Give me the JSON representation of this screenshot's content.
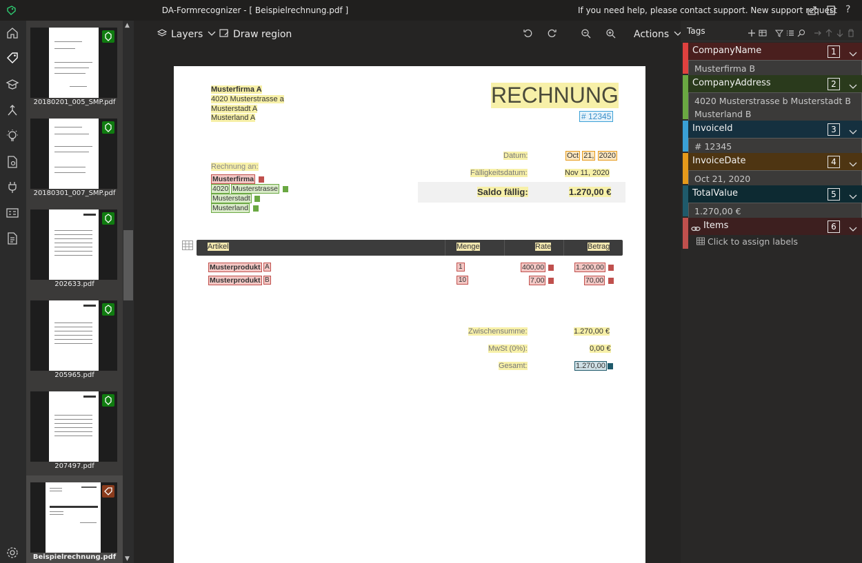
{
  "titlebar": {
    "title": "DA-Formrecognizer - [ Beispielrechnung.pdf ]",
    "help": "If you need help, please contact support. New support request"
  },
  "rail": [
    "home-icon",
    "tag-icon",
    "train-icon",
    "merge-icon",
    "lightbulb-icon",
    "document-analyze-icon",
    "plug-icon",
    "id-card-icon",
    "document-icon",
    "settings-icon"
  ],
  "thumbnails": [
    {
      "name": "20180201_005_SMP.pdf",
      "badge": "check"
    },
    {
      "name": "20180301_007_SMP.pdf",
      "badge": "check"
    },
    {
      "name": "202633.pdf",
      "badge": "check"
    },
    {
      "name": "205965.pdf",
      "badge": "check"
    },
    {
      "name": "207497.pdf",
      "badge": "check"
    },
    {
      "name": "Beispielrechnung.pdf",
      "badge": "tag"
    }
  ],
  "toolbar": {
    "layers": "Layers",
    "draw_region": "Draw region",
    "actions": "Actions"
  },
  "document": {
    "sender": [
      "Musterfirma A",
      "4020 Musterstrasse a",
      "Musterstadt A",
      "Musterland A"
    ],
    "heading": "RECHNUNG",
    "invoice_no": "# 12345",
    "datum_label": "Datum:",
    "datum_parts": [
      "Oct",
      "21,",
      "2020"
    ],
    "faellig_label": "Fälligkeitsdatum:",
    "faellig_value": "Nov 11, 2020",
    "saldo_label": "Saldo fällig:",
    "saldo_value": "1.270,00 €",
    "rechnung_an": "Rechnung an:",
    "recipient": [
      "Musterfirma",
      "4020",
      "Musterstrasse",
      "Musterstadt",
      "Musterland"
    ],
    "table_headers": [
      "Artikel",
      "Menge",
      "Rate",
      "Betrag"
    ],
    "rows": [
      {
        "product": "Musterprodukt",
        "suffix": "A",
        "qty": "1",
        "rate": "400,00",
        "amount": "1.200,00"
      },
      {
        "product": "Musterprodukt",
        "suffix": "B",
        "qty": "10",
        "rate": "7,00",
        "amount": "70,00"
      }
    ],
    "zwischensumme_label": "Zwischensumme:",
    "zwischensumme_value": "1.270,00 €",
    "mwst_label": "MwSt (0%):",
    "mwst_value": "0,00 €",
    "gesamt_label": "Gesamt:",
    "gesamt_value": "1.270,00"
  },
  "tags_panel": {
    "title": "Tags",
    "items": [
      {
        "name": "CompanyName",
        "num": "1",
        "value": "Musterfirma B",
        "color": "#e0413f",
        "bg": "#4a1f1e"
      },
      {
        "name": "CompanyAddress",
        "num": "2",
        "value": "4020 Musterstrasse b Musterstadt B Musterland B",
        "color": "#6aa842",
        "bg": "#2a3a1c"
      },
      {
        "name": "InvoiceId",
        "num": "3",
        "value": "# 12345",
        "color": "#3aa0d6",
        "bg": "#15303f"
      },
      {
        "name": "InvoiceDate",
        "num": "4",
        "value": "Oct 21, 2020",
        "color": "#e69a1b",
        "bg": "#4e3512"
      },
      {
        "name": "TotalValue",
        "num": "5",
        "value": "1.270,00 €",
        "color": "#1f5a6b",
        "bg": "#0d2a32"
      },
      {
        "name": "Items",
        "num": "6",
        "value": "Click to assign labels",
        "color": "#c0504d",
        "bg": "#3d1f1f"
      }
    ]
  }
}
